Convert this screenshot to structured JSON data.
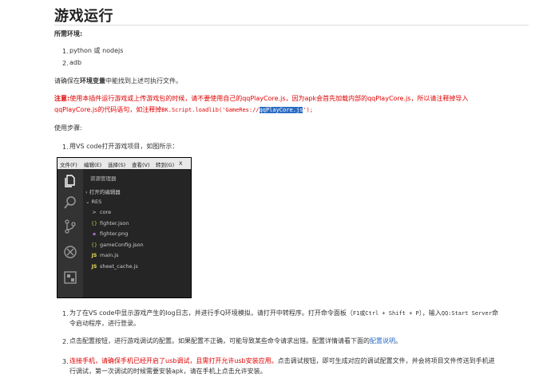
{
  "title": "游戏运行",
  "env_heading": "所需环境:",
  "env_items": [
    "python 或 nodejs",
    "adb"
  ],
  "env_note": {
    "pre": "请确保在",
    "bold": "环境变量",
    "post": "中能找到上述可执行文件。"
  },
  "warning": {
    "label": "注意:",
    "line1": "使用本插件运行游戏或上传游戏包的时候，请不要使用自己的qqPlayCore.js，因为apk会首先加载内部的qqPlayCore.js，所以请注释掉导入",
    "line2_pre": "qqPlayCore.js的代码语句，如注释掉",
    "code_pre": "BK.Script.loadlib('GameRes://",
    "code_hl": "qqPlayCore.js",
    "code_post": "');"
  },
  "steps_heading": "使用步骤:",
  "step1": "用VS code打开游戏项目，如图所示：",
  "editor": {
    "menu": [
      "文件(F)",
      "编辑(E)",
      "选择(S)",
      "查看(V)",
      "转到(G)",
      "X"
    ],
    "panel_title": "资源管理器",
    "open_editors": "打开的编辑器",
    "res": "RES",
    "files": [
      {
        "icon": ">",
        "name": "core"
      },
      {
        "icon": "{}",
        "name": "fighter.json"
      },
      {
        "icon": "▪",
        "name": "fighter.png"
      },
      {
        "icon": "{}",
        "name": "gameConfig.json"
      },
      {
        "icon": "JS",
        "name": "main.js"
      },
      {
        "icon": "JS",
        "name": "sheet_cache.js"
      }
    ],
    "colors": {
      "bg": "#252526",
      "activity": "#333333",
      "json": "#cbcb41",
      "js": "#f1e05a",
      "png": "#a074c4"
    }
  },
  "step2": {
    "line1_pre": "为了在VS code中显示游戏产生的log日志，并进行手Q环境模拟，请打开中转程序。打开命令面板（",
    "line1_code": "F1或Ctrl + Shift + P",
    "line1_mid": "），输入",
    "line1_code2": "QQ:Start Server",
    "line1_post": "命",
    "line2": "令启动程序，进行登录。"
  },
  "step3": {
    "pre": "点击配置按钮，进行游戏调试的配置。如果配置不正确，可能导致某些命令请求出错。配置详情请看下面的",
    "link": "配置说明",
    "post": "。"
  },
  "step4": {
    "red": "连接手机，请确保手机已经开启了usb调试，且需打开允许usb安装应用。",
    "line1_post": "点击调试按钮，即可生成对应的调试配置文件，并会将项目文件传送到手机进",
    "line2": "行调试，第一次调试的时候需要安装apk，请在手机上点击允许安装。"
  }
}
